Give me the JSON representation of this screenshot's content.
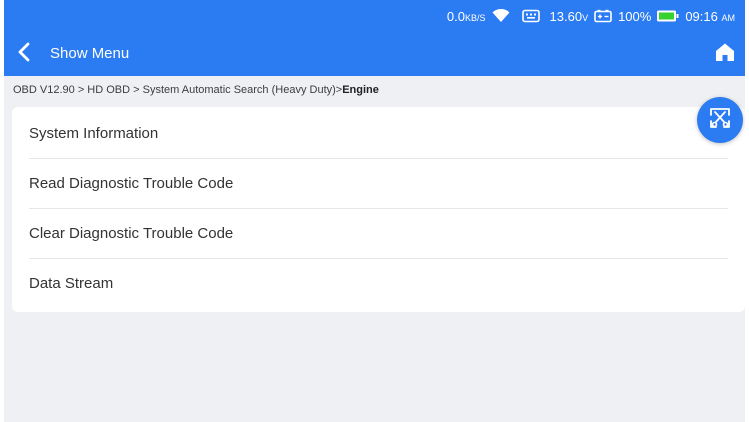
{
  "status_bar": {
    "net_speed_value": "0.0",
    "net_speed_unit": "KB/S",
    "voltage_value": "13.60",
    "voltage_unit": "V",
    "battery_percent": "100%",
    "time": "09:16",
    "time_ampm": "AM",
    "color": "#2b7cf2"
  },
  "app_bar": {
    "title": "Show Menu"
  },
  "breadcrumb": {
    "path": "OBD V12.90 > HD OBD > System Automatic Search (Heavy Duty)>",
    "current": "Engine"
  },
  "menu": {
    "items": [
      {
        "label": "System Information"
      },
      {
        "label": "Read Diagnostic Trouble Code"
      },
      {
        "label": "Clear Diagnostic Trouble Code"
      },
      {
        "label": "Data Stream"
      }
    ]
  },
  "icons": {
    "back": "chevron-left-icon",
    "home": "home-icon",
    "fab": "screenshot-scissors-icon",
    "wifi": "wifi-icon",
    "vci": "vci-connector-icon",
    "car_battery": "car-battery-icon",
    "battery": "battery-icon"
  }
}
